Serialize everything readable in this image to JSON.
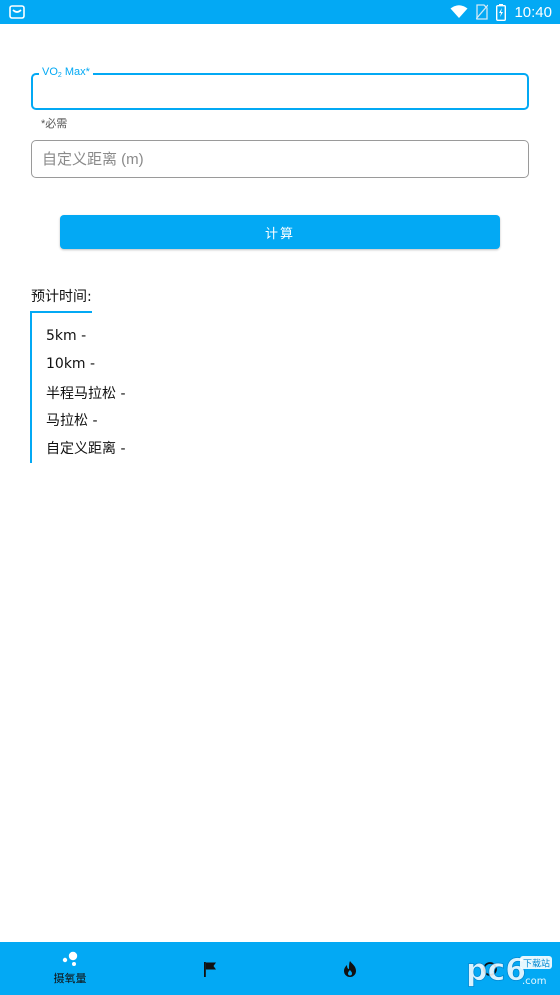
{
  "status_bar": {
    "time": "10:40",
    "icons": [
      "shopping-bag-icon",
      "wifi-icon",
      "no-sim-icon",
      "battery-charging-icon"
    ]
  },
  "form": {
    "vo2_label_main": "VO",
    "vo2_label_sub": "2",
    "vo2_label_rest": " Max*",
    "vo2_value": "",
    "vo2_helper": "*必需",
    "distance_placeholder": "自定义距离 (m)",
    "distance_value": ""
  },
  "calculate_button": "计算",
  "results": {
    "title": "预计时间:",
    "rows": [
      "5km -",
      "10km -",
      "半程马拉松 -",
      "马拉松 -",
      "自定义距离 -"
    ]
  },
  "bottom_nav": {
    "items": [
      {
        "icon": "molecule-icon",
        "label": "摄氧量",
        "active": true
      },
      {
        "icon": "flag-icon",
        "label": ""
      },
      {
        "icon": "flame-icon",
        "label": ""
      },
      {
        "icon": "more-icon",
        "label": ""
      }
    ]
  },
  "watermark": {
    "logo_text": "pc6",
    "sub_text": "下载站"
  },
  "colors": {
    "accent": "#03a9f4",
    "text": "#111111",
    "border": "#9a9a9a"
  }
}
